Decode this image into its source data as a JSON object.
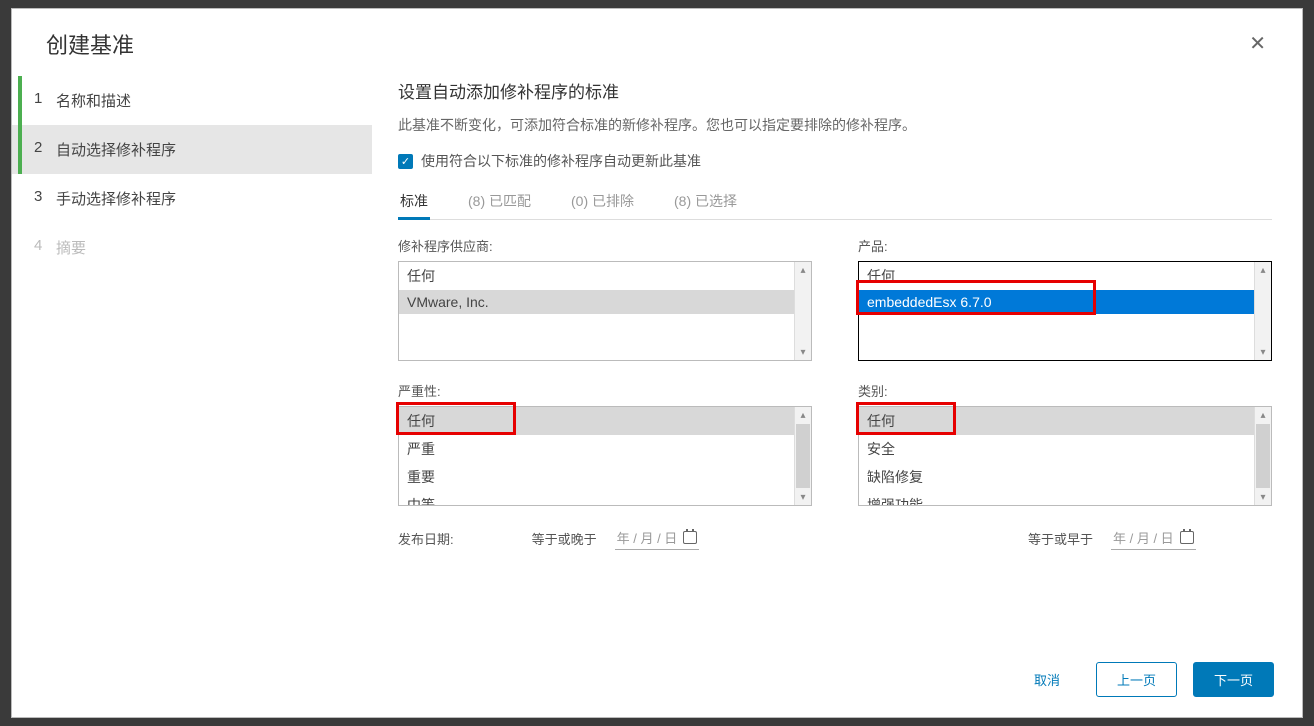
{
  "modal": {
    "title": "创建基准"
  },
  "wizard": {
    "steps": [
      {
        "num": "1",
        "label": "名称和描述"
      },
      {
        "num": "2",
        "label": "自动选择修补程序"
      },
      {
        "num": "3",
        "label": "手动选择修补程序"
      },
      {
        "num": "4",
        "label": "摘要"
      }
    ]
  },
  "panel": {
    "heading": "设置自动添加修补程序的标准",
    "description": "此基准不断变化，可添加符合标准的新修补程序。您也可以指定要排除的修补程序。",
    "auto_update_label": "使用符合以下标准的修补程序自动更新此基准"
  },
  "tabs": [
    "标准",
    "(8) 已匹配",
    "(0) 已排除",
    "(8) 已选择"
  ],
  "fields": {
    "vendor": {
      "label": "修补程序供应商:",
      "options": [
        "任何",
        "VMware, Inc."
      ]
    },
    "product": {
      "label": "产品:",
      "options": [
        "任何",
        "embeddedEsx 6.7.0"
      ]
    },
    "severity": {
      "label": "严重性:",
      "options": [
        "任何",
        "严重",
        "重要",
        "中等"
      ]
    },
    "category": {
      "label": "类别:",
      "options": [
        "任何",
        "安全",
        "缺陷修复",
        "增强功能"
      ]
    },
    "release_date": {
      "label": "发布日期:",
      "gte": "等于或晚于",
      "lte": "等于或早于",
      "placeholder": "年 / 月 / 日"
    }
  },
  "footer": {
    "cancel": "取消",
    "prev": "上一页",
    "next": "下一页"
  }
}
